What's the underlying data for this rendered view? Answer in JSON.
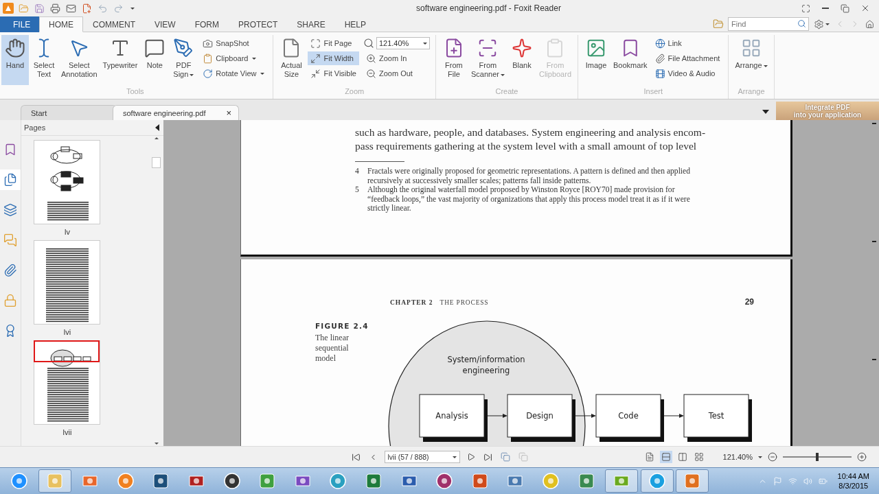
{
  "window": {
    "title": "software engineering.pdf - Foxit Reader"
  },
  "menu_tabs": [
    {
      "label": "FILE",
      "kind": "file",
      "selected": false
    },
    {
      "label": "HOME",
      "kind": "tab",
      "selected": true
    },
    {
      "label": "COMMENT",
      "kind": "tab",
      "selected": false
    },
    {
      "label": "VIEW",
      "kind": "tab",
      "selected": false
    },
    {
      "label": "FORM",
      "kind": "tab",
      "selected": false
    },
    {
      "label": "PROTECT",
      "kind": "tab",
      "selected": false
    },
    {
      "label": "SHARE",
      "kind": "tab",
      "selected": false
    },
    {
      "label": "HELP",
      "kind": "tab",
      "selected": false
    }
  ],
  "find": {
    "placeholder": "Find"
  },
  "ribbon": [
    {
      "label": "Tools",
      "items": [
        {
          "kind": "large",
          "lines": [
            "Hand"
          ],
          "selected": true,
          "disabled": false
        },
        {
          "kind": "large",
          "lines": [
            "Select",
            "Text"
          ],
          "selected": false,
          "disabled": false
        },
        {
          "kind": "large",
          "lines": [
            "Select",
            "Annotation"
          ],
          "selected": false,
          "disabled": false
        },
        {
          "kind": "large",
          "lines": [
            "Typewriter"
          ],
          "selected": false,
          "disabled": false
        },
        {
          "kind": "large",
          "lines": [
            "Note"
          ],
          "selected": false,
          "disabled": false
        },
        {
          "kind": "large",
          "lines": [
            "PDF",
            "Sign"
          ],
          "dropdown": true,
          "selected": false,
          "disabled": false
        },
        {
          "kind": "column",
          "items": [
            {
              "kind": "button",
              "label": "SnapShot",
              "selected": false
            },
            {
              "kind": "button",
              "label": "Clipboard",
              "dropdown": true,
              "selected": false
            },
            {
              "kind": "button",
              "label": "Rotate View",
              "dropdown": true,
              "selected": false
            }
          ]
        }
      ]
    },
    {
      "label": "Zoom",
      "items": [
        {
          "kind": "large",
          "lines": [
            "Actual",
            "Size"
          ],
          "selected": false,
          "disabled": false
        },
        {
          "kind": "column",
          "items": [
            {
              "kind": "button",
              "label": "Fit Page",
              "selected": false
            },
            {
              "kind": "button",
              "label": "Fit Width",
              "selected": true
            },
            {
              "kind": "button",
              "label": "Fit Visible",
              "selected": false
            }
          ]
        },
        {
          "kind": "column",
          "items": [
            {
              "kind": "combo",
              "value": "121.40%"
            },
            {
              "kind": "button",
              "label": "Zoom In",
              "selected": false
            },
            {
              "kind": "button",
              "label": "Zoom Out",
              "selected": false
            }
          ]
        }
      ]
    },
    {
      "label": "Create",
      "items": [
        {
          "kind": "large",
          "lines": [
            "From",
            "File"
          ],
          "selected": false,
          "disabled": false
        },
        {
          "kind": "large",
          "lines": [
            "From",
            "Scanner"
          ],
          "dropdown": true,
          "selected": false,
          "disabled": false
        },
        {
          "kind": "large",
          "lines": [
            "Blank"
          ],
          "selected": false,
          "disabled": false
        },
        {
          "kind": "large",
          "lines": [
            "From",
            "Clipboard"
          ],
          "selected": false,
          "disabled": true
        }
      ]
    },
    {
      "label": "Insert",
      "items": [
        {
          "kind": "large",
          "lines": [
            "Image"
          ],
          "selected": false,
          "disabled": false
        },
        {
          "kind": "large",
          "lines": [
            "Bookmark"
          ],
          "selected": false,
          "disabled": false
        },
        {
          "kind": "column",
          "items": [
            {
              "kind": "button",
              "label": "Link",
              "selected": false
            },
            {
              "kind": "button",
              "label": "File Attachment",
              "selected": false
            },
            {
              "kind": "button",
              "label": "Video & Audio",
              "selected": false
            }
          ]
        }
      ]
    },
    {
      "label": "Arrange",
      "items": [
        {
          "kind": "large",
          "lines": [
            "Arrange"
          ],
          "dropdown": true,
          "selected": false,
          "disabled": false
        }
      ]
    }
  ],
  "doc_tabs": [
    {
      "label": "Start",
      "selected": false
    },
    {
      "label": "software engineering.pdf",
      "selected": true,
      "close": "×"
    }
  ],
  "ad": {
    "lines": [
      "Integrate PDF",
      "into your application"
    ]
  },
  "side_rail": [
    {
      "selected": false
    },
    {
      "selected": true
    },
    {
      "selected": false
    },
    {
      "selected": false
    },
    {
      "selected": false
    },
    {
      "selected": false
    },
    {
      "selected": false
    }
  ],
  "pages_panel": {
    "title": "Pages",
    "thumbnails": [
      {
        "label": "lv",
        "selected": false
      },
      {
        "label": "lvi",
        "selected": false
      },
      {
        "label": "lvii",
        "selected": true
      }
    ]
  },
  "document": {
    "page_1": {
      "body_lines": [
        "such as hardware, people, and databases. System engineering and analysis encom-",
        "pass requirements gathering at the system level with a small amount of top level"
      ],
      "footnotes": [
        {
          "number": "4",
          "text": "Fractals were originally proposed for geometric representations. A pattern is defined and then applied recursively at successively smaller scales; patterns fall inside patterns."
        },
        {
          "number": "5",
          "text": "Although the original waterfall model proposed by Winston Royce [ROY70] made provision for “feedback loops,” the vast majority of organizations that apply this process model treat it as if it were strictly linear."
        }
      ]
    },
    "page_2": {
      "chapter": "CHAPTER 2",
      "chapter_title": "THE PROCESS",
      "page_number": "29",
      "figure_label": "FIGURE 2.4",
      "figure_caption": "The linear sequential model",
      "diagram": {
        "ellipse_label": [
          "System/information",
          "engineering"
        ],
        "steps": [
          "Analysis",
          "Design",
          "Code",
          "Test"
        ]
      }
    }
  },
  "status_bar": {
    "page_field": "lvii (57 / 888)",
    "view_modes": [
      {
        "selected": false
      },
      {
        "selected": true
      },
      {
        "selected": false
      },
      {
        "selected": false
      }
    ],
    "zoom": "121.40%",
    "zoom_slider": {
      "level": 0.5
    }
  },
  "taskbar": {
    "apps": [
      {
        "selected": false
      },
      {
        "selected": true
      },
      {
        "selected": false
      },
      {
        "selected": false
      },
      {
        "selected": false
      },
      {
        "selected": false
      },
      {
        "selected": false
      },
      {
        "selected": false
      },
      {
        "selected": false
      },
      {
        "selected": false
      },
      {
        "selected": false
      },
      {
        "selected": false
      },
      {
        "selected": false
      },
      {
        "selected": false
      },
      {
        "selected": false
      },
      {
        "selected": false
      },
      {
        "selected": false
      },
      {
        "selected": true
      },
      {
        "selected": true
      },
      {
        "selected": true
      }
    ],
    "time": "10:44 AM",
    "date": "8/3/2015"
  }
}
